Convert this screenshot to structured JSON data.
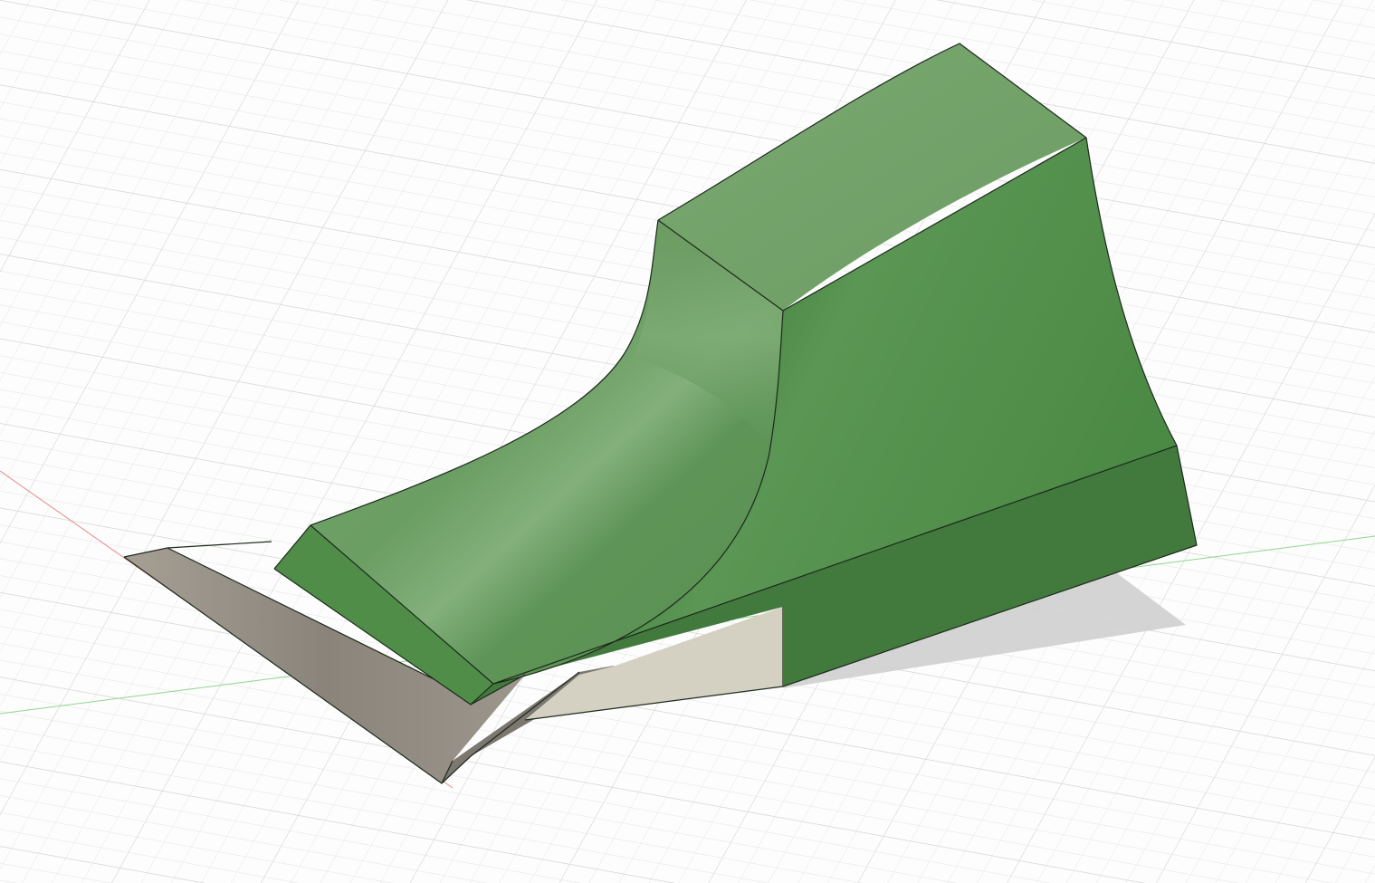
{
  "viewport": {
    "background": "#fdfdfd",
    "grid_minor_color": "#e6e6e6",
    "grid_major_color": "#d2d2d2",
    "x_axis_color": "#e98a8a",
    "y_axis_color": "#8fd68f"
  },
  "model": {
    "body_color": "#4a8a45",
    "body_light_color": "#6fa266",
    "body_dark_color": "#427a3e",
    "base_color": "#9b958b",
    "base_dark_color": "#6e6a64",
    "support_color": "#d4d1c3",
    "shadow_color": "#cfcfcf",
    "edge_color": "#1c2a1c"
  },
  "legend": {
    "body_label": "",
    "base_label": ""
  }
}
